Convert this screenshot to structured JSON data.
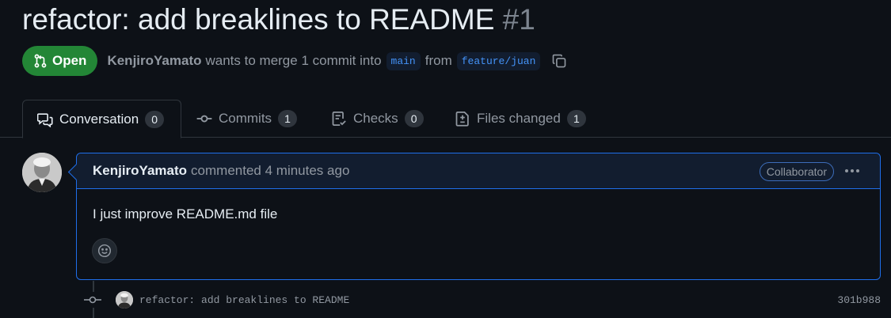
{
  "pr": {
    "title": "refactor: add breaklines to README",
    "number": "#1",
    "state": "Open",
    "author": "KenjiroYamato",
    "merge_text": "wants to merge 1 commit into",
    "base_branch": "main",
    "from_text": "from",
    "head_branch": "feature/juan"
  },
  "tabs": [
    {
      "label": "Conversation",
      "count": "0",
      "icon": "comment-discussion-icon"
    },
    {
      "label": "Commits",
      "count": "1",
      "icon": "git-commit-icon"
    },
    {
      "label": "Checks",
      "count": "0",
      "icon": "checklist-icon"
    },
    {
      "label": "Files changed",
      "count": "1",
      "icon": "file-diff-icon"
    }
  ],
  "comment": {
    "author": "KenjiroYamato",
    "action": "commented",
    "time": "4 minutes ago",
    "role": "Collaborator",
    "body": "I just improve README.md file"
  },
  "commit": {
    "message": "refactor: add breaklines to README",
    "sha": "301b988"
  },
  "colors": {
    "background": "#0d1117",
    "open_green": "#238636",
    "accent_blue": "#1f6feb",
    "branch_blue": "#4493f8"
  }
}
